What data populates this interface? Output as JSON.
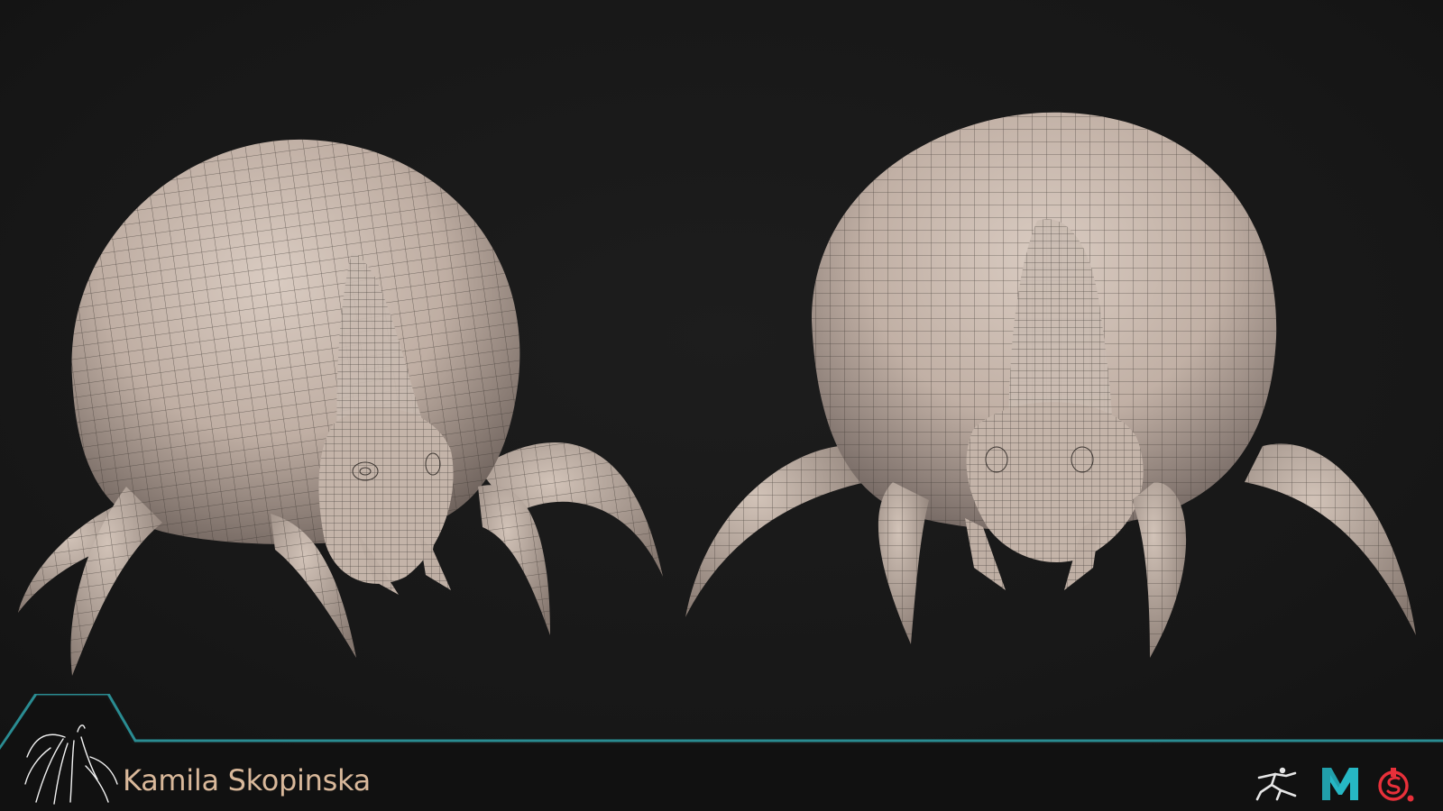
{
  "artist": {
    "name": "Kamila Skopinska",
    "signature_icon": "spider-signature-logo"
  },
  "renders": [
    {
      "name": "tick-model-three-quarter-view",
      "shading": "clay",
      "overlay": "wireframe"
    },
    {
      "name": "tick-model-front-view",
      "shading": "clay",
      "overlay": "wireframe"
    }
  ],
  "software_icons": [
    "zbrush-icon",
    "maya-icon",
    "substance-painter-icon"
  ],
  "colors": {
    "background": "#181818",
    "accent_teal": "#2a8c92",
    "name_text": "#d9b89a",
    "clay": "#c8b8ad",
    "wire": "#3a3430",
    "maya_teal": "#26b7c4",
    "substance_red": "#e8303a"
  }
}
